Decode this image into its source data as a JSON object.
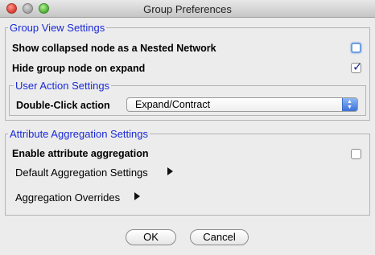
{
  "window": {
    "title": "Group Preferences"
  },
  "group_view": {
    "legend": "Group View Settings",
    "collapsed_label": "Show collapsed node as a Nested Network",
    "collapsed_checked": false,
    "hide_label": "Hide group node on expand",
    "hide_checked": true,
    "user_action": {
      "legend": "User Action Settings",
      "double_click_label": "Double-Click action",
      "double_click_value": "Expand/Contract"
    }
  },
  "aggregation": {
    "legend": "Attribute Aggregation Settings",
    "enable_label": "Enable attribute aggregation",
    "enable_checked": false,
    "default_label": "Default Aggregation Settings",
    "overrides_label": "Aggregation Overrides"
  },
  "buttons": {
    "ok": "OK",
    "cancel": "Cancel"
  },
  "icons": {
    "checkmark": "✓",
    "select_up": "▲",
    "select_down": "▼"
  },
  "colors": {
    "legend": "#1a2ad6",
    "accent": "#3a72d9"
  }
}
